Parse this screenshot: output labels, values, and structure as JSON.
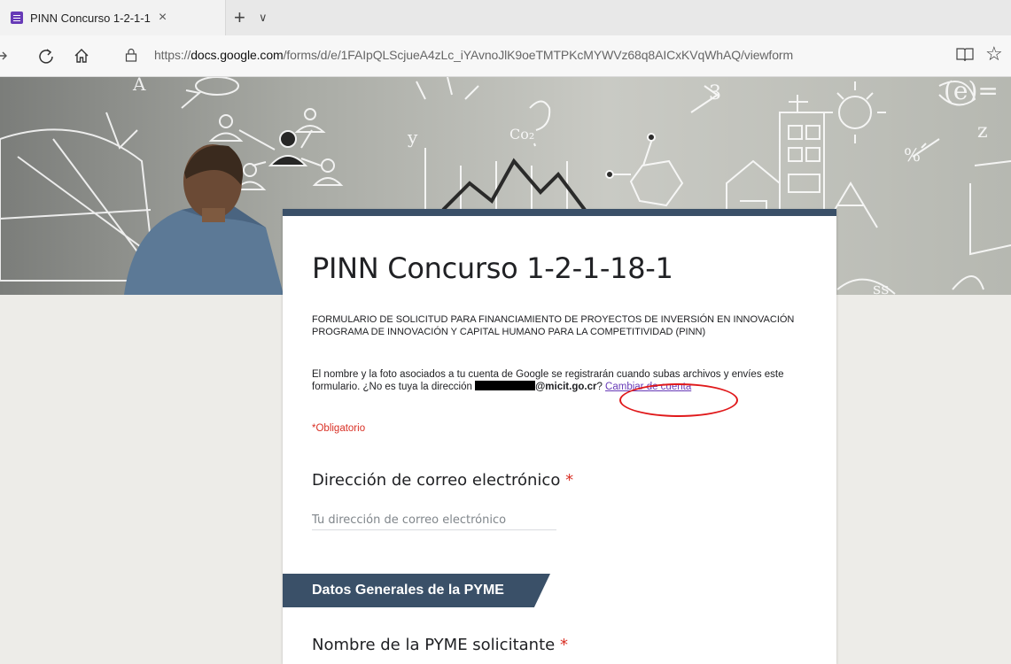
{
  "browser": {
    "tab_title": "PINN Concurso 1-2-1-1",
    "tab_close": "×",
    "new_tab": "+",
    "tab_menu": "∨",
    "url_prefix": "https://",
    "url_domain": "docs.google.com",
    "url_path": "/forms/d/e/1FAIpQLScjueA4zLc_iYAvnoJlK9oeTMTPKcMYWVz68q8AICxKVqWhAQ/viewform",
    "icons": [
      "forward-icon",
      "refresh-icon",
      "home-icon",
      "lock-icon",
      "reading-view-icon",
      "favorite-star-icon"
    ]
  },
  "form": {
    "title": "PINN Concurso 1-2-1-18-1",
    "description_line1": "FORMULARIO DE SOLICITUD PARA FINANCIAMIENTO DE PROYECTOS DE INVERSIÓN EN INNOVACIÓN",
    "description_line2": "PROGRAMA DE INNOVACIÓN Y CAPITAL HUMANO PARA LA COMPETITIVIDAD (PINN)",
    "notice_text": "El nombre y la foto asociados a tu cuenta de Google se registrarán cuando subas archivos y envíes este formulario. ¿No es tuya la dirección ",
    "email_domain": "@micit.go.cr",
    "notice_after": "? ",
    "switch_account": "Cambiar de cuenta",
    "required_note": "*Obligatorio",
    "q1_title": "Dirección de correo electrónico",
    "asterisk": "*",
    "q1_placeholder": "Tu dirección de correo electrónico",
    "section_title": "Datos Generales de la PYME",
    "q2_title": "Nombre de la PYME solicitante"
  },
  "colors": {
    "header_accent": "#3a5068",
    "link": "#673ab7",
    "required": "#d93025",
    "annotation_circle": "#e0191b"
  }
}
